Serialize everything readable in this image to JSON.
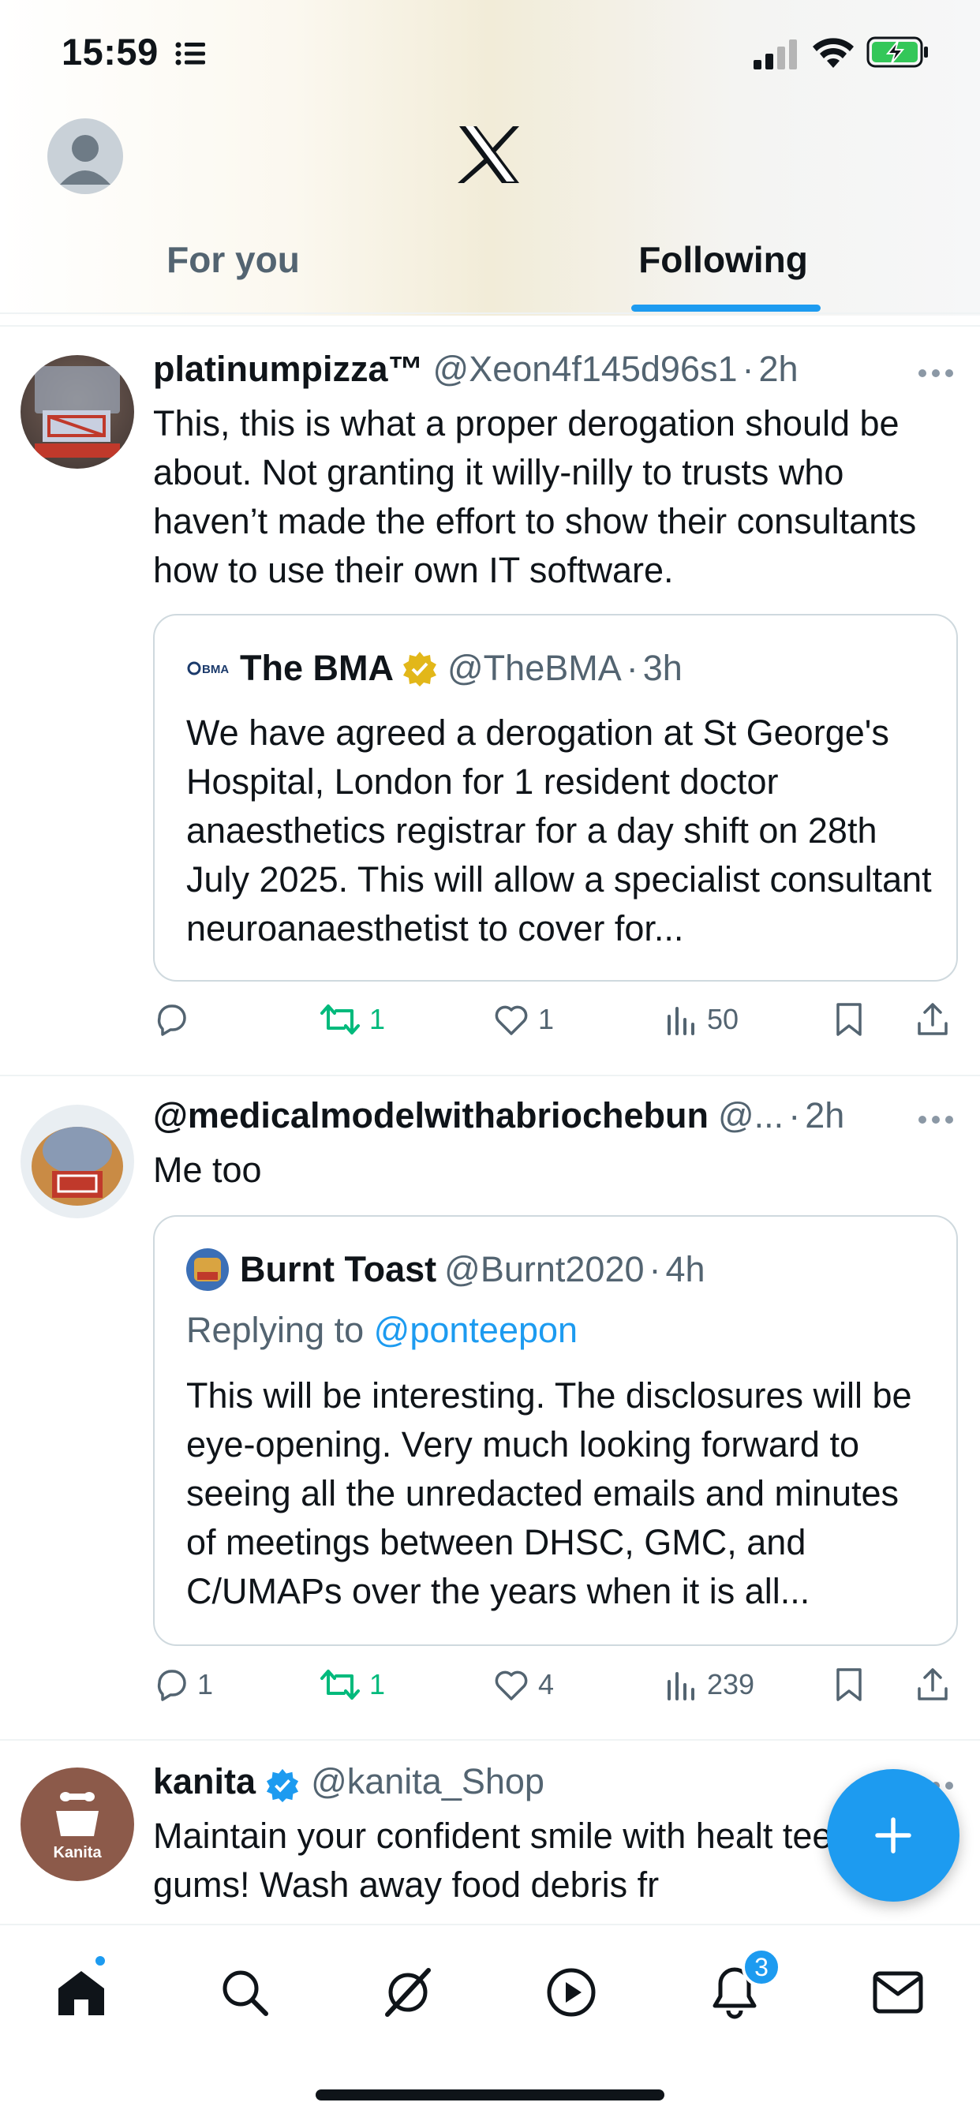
{
  "status_bar": {
    "time": "15:59"
  },
  "tabs": {
    "for_you": "For you",
    "following": "Following"
  },
  "tweets": [
    {
      "name": "platinumpizza™",
      "handle": "@Xeon4f145d96s1",
      "dot": "·",
      "time": "2h",
      "text": "This, this is what a proper derogation should be about. Not granting it willy-nilly to trusts who haven’t made the effort to show their consultants how to use their own IT software.",
      "quote": {
        "name": "The BMA",
        "handle": "@TheBMA",
        "dot": "·",
        "time": "3h",
        "avatar_text": "BMA",
        "verified": "gold",
        "text": "We have agreed a derogation at St George's Hospital, London for 1 resident doctor anaesthetics registrar for a day shift on 28th July 2025. This will allow a specialist consultant neuroanaesthetist to cover for..."
      },
      "actions": {
        "replies": "",
        "retweets": "1",
        "likes": "1",
        "views": "50"
      }
    },
    {
      "name": "@medicalmodelwithabriochebun",
      "handle": "@...",
      "dot": "·",
      "time": "2h",
      "text": "Me too",
      "quote": {
        "name": "Burnt Toast",
        "handle": "@Burnt2020",
        "dot": "·",
        "time": "4h",
        "replying_label": "Replying to",
        "replying_handle": "@ponteepon",
        "text": "This will be interesting. The disclosures will be eye-opening. Very much looking forward to seeing all the unredacted emails and minutes of meetings between DHSC, GMC, and C/UMAPs over the years when it is all..."
      },
      "actions": {
        "replies": "1",
        "retweets": "1",
        "likes": "4",
        "views": "239"
      }
    },
    {
      "name": "kanita",
      "handle": "@kanita_Shop",
      "avatar_text": "Kanita",
      "verified": "blue",
      "text": "Maintain your confident smile with healt teeth and gums! Wash away food debris fr"
    }
  ],
  "tabbar": {
    "notifications_badge": "3"
  },
  "colors": {
    "accent": "#1d9bf0",
    "retweet_green": "#00ba7c",
    "secondary_text": "#536471",
    "border": "#cfd9de"
  }
}
